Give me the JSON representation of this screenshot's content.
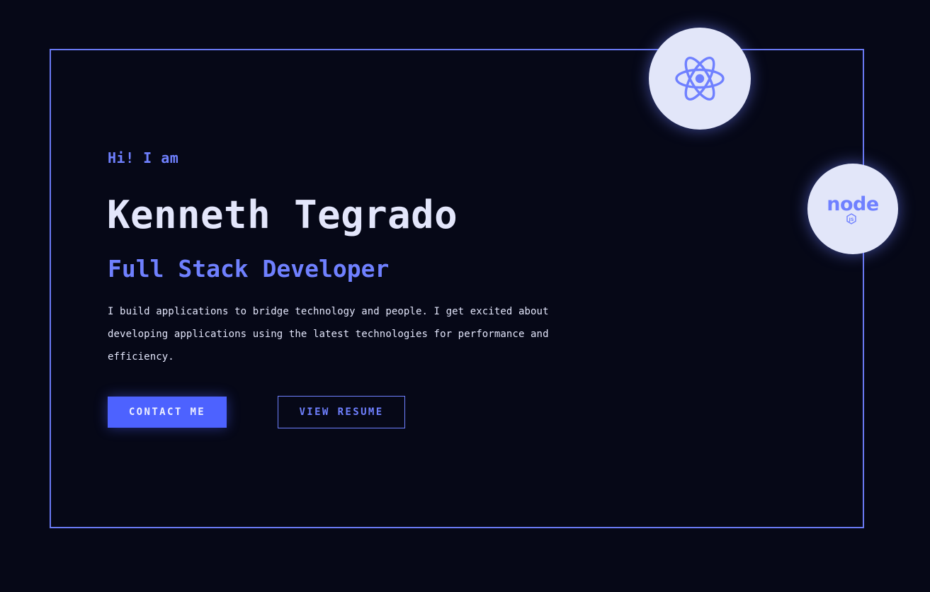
{
  "hero": {
    "greeting": "Hi! I am",
    "name": "Kenneth Tegrado",
    "role": "Full Stack Developer",
    "bio": "I build applications to bridge technology and people. I get excited about developing applications using the latest technologies for performance and efficiency."
  },
  "actions": {
    "contact_label": "CONTACT ME",
    "resume_label": "VIEW RESUME"
  },
  "badges": [
    {
      "icon": "react-icon"
    },
    {
      "icon": "nodejs-icon",
      "text": "node",
      "subtext": "JS"
    }
  ],
  "colors": {
    "background": "#060817",
    "accent": "#6f80ff",
    "primary_button": "#4d62ff",
    "text": "#e3e6fb",
    "badge_background": "#e2e6f9"
  }
}
